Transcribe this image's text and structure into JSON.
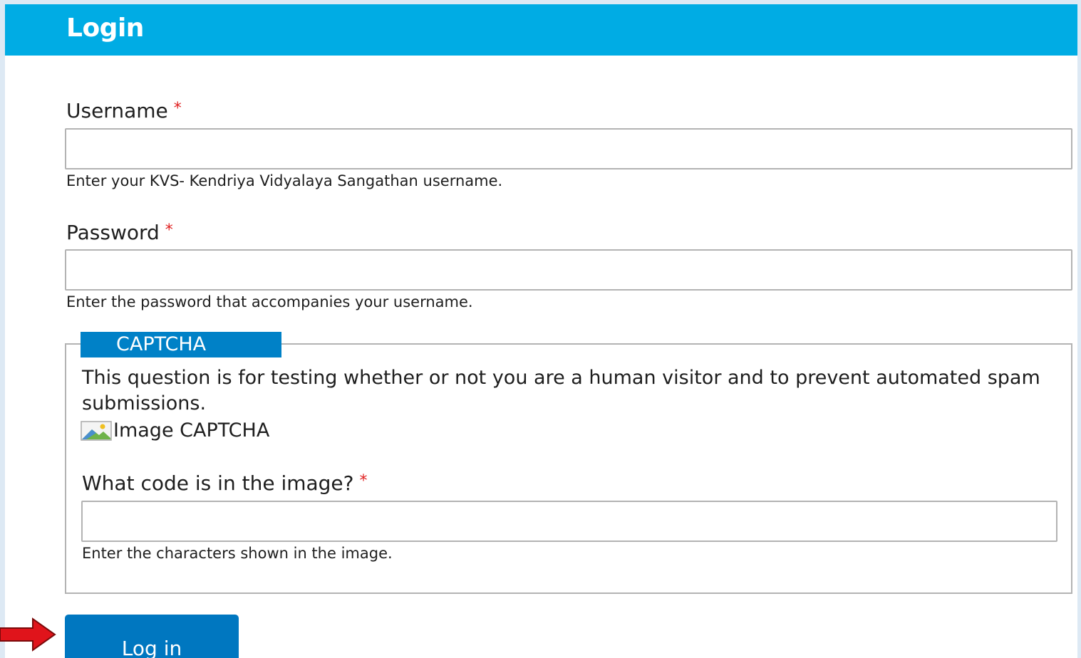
{
  "header": {
    "title": "Login"
  },
  "form": {
    "username": {
      "label": "Username",
      "required_marker": "*",
      "value": "",
      "help": "Enter your KVS- Kendriya Vidyalaya Sangathan username."
    },
    "password": {
      "label": "Password",
      "required_marker": "*",
      "value": "",
      "help": "Enter the password that accompanies your username."
    },
    "captcha": {
      "legend": "CAPTCHA",
      "description": "This question is for testing whether or not you are a human visitor and to prevent automated spam submissions.",
      "image_alt": "Image CAPTCHA",
      "code_label": "What code is in the image?",
      "required_marker": "*",
      "value": "",
      "help": "Enter the characters shown in the image."
    },
    "submit_label": "Log in"
  },
  "annotation": {
    "arrow_icon": "right-arrow-icon",
    "arrow_color": "#e0141b"
  },
  "colors": {
    "header_bg": "#00ace4",
    "legend_bg": "#0081c7",
    "button_bg": "#0077c0",
    "required": "#e02020",
    "page_bg": "#dde9f4"
  }
}
